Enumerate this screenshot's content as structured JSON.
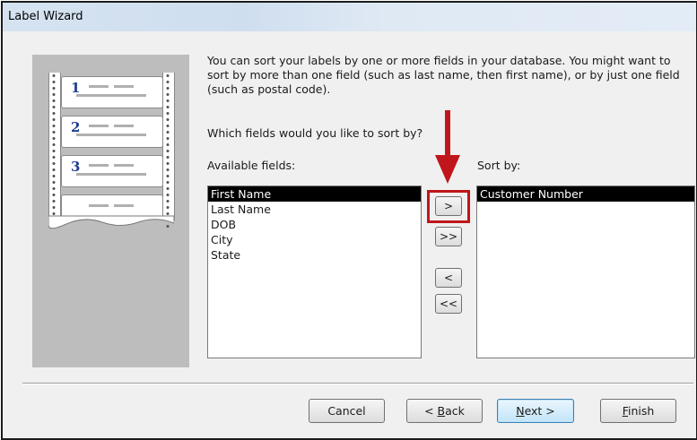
{
  "window": {
    "title": "Label Wizard"
  },
  "illustration": {
    "label_numbers": [
      "1",
      "2",
      "3"
    ]
  },
  "intro_text": "You can sort your labels by one or more fields in your database.  You might want to sort by more than one field (such as last name, then first name), or by just one field (such as postal code).",
  "question": "Which fields would you like to sort by?",
  "available": {
    "label": "Available fields:",
    "items": [
      "First Name",
      "Last Name",
      "DOB",
      "City",
      "State"
    ],
    "selected": "First Name"
  },
  "sort_by": {
    "label": "Sort by:",
    "items": [
      "Customer Number"
    ],
    "selected": "Customer Number"
  },
  "move_buttons": {
    "add_one": ">",
    "add_all": ">>",
    "remove_one": "<",
    "remove_all": "<<"
  },
  "footer": {
    "cancel": "Cancel",
    "back_prefix": "< ",
    "back_mnemonic": "B",
    "back_rest": "ack",
    "next_mnemonic": "N",
    "next_rest": "ext >",
    "finish_mnemonic": "F",
    "finish_rest": "inish"
  },
  "colors": {
    "highlight_red": "#c0161b",
    "selection": "#000000"
  }
}
